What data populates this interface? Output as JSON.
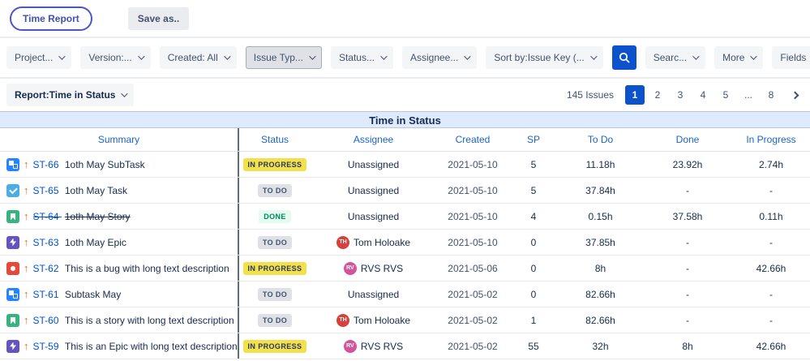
{
  "header": {
    "time_report_label": "Time Report",
    "save_as_label": "Save as.."
  },
  "filters": {
    "project": "Project...",
    "version": "Version:...",
    "created": "Created: All",
    "issue_type": "Issue Typ...",
    "status": "Status...",
    "assignee": "Assignee...",
    "sort_by": "Sort by:Issue Key (...",
    "search": "Searc...",
    "more": "More",
    "fields": "Fields"
  },
  "report_bar": {
    "report_selector_label": "Report:Time in Status",
    "issues_count": "145 Issues",
    "pages": [
      "1",
      "2",
      "3",
      "4",
      "5",
      "...",
      "8"
    ],
    "active_page": "1"
  },
  "table": {
    "title": "Time in Status",
    "columns": [
      "Summary",
      "Status",
      "Assignee",
      "Created",
      "SP",
      "To Do",
      "Done",
      "In Progress"
    ],
    "rows": [
      {
        "issue_type": "subtask",
        "priority": "high",
        "key": "ST-66",
        "summary": "1oth May SubTask",
        "resolved": false,
        "status": "IN PROGRESS",
        "assignee": "Unassigned",
        "avatar": null,
        "created": "2021-05-10",
        "sp": "5",
        "to_do": "11.18h",
        "done": "23.92h",
        "in_progress": "2.74h"
      },
      {
        "issue_type": "task",
        "priority": "high",
        "key": "ST-65",
        "summary": "1oth May Task",
        "resolved": false,
        "status": "TO DO",
        "assignee": "Unassigned",
        "avatar": null,
        "created": "2021-05-10",
        "sp": "5",
        "to_do": "37.84h",
        "done": "-",
        "in_progress": "-"
      },
      {
        "issue_type": "story",
        "priority": "high",
        "key": "ST-64",
        "summary": "1oth May Story",
        "resolved": true,
        "status": "DONE",
        "assignee": "Unassigned",
        "avatar": null,
        "created": "2021-05-10",
        "sp": "4",
        "to_do": "0.15h",
        "done": "37.58h",
        "in_progress": "0.11h"
      },
      {
        "issue_type": "epic",
        "priority": "high",
        "key": "ST-63",
        "summary": "1oth May Epic",
        "resolved": false,
        "status": "TO DO",
        "assignee": "Tom Holoake",
        "avatar": {
          "color": "#D5423B",
          "initials": "TH"
        },
        "created": "2021-05-10",
        "sp": "0",
        "to_do": "37.85h",
        "done": "-",
        "in_progress": "-"
      },
      {
        "issue_type": "bug",
        "priority": "high",
        "key": "ST-62",
        "summary": "This is a bug with long text description",
        "resolved": false,
        "status": "IN PROGRESS",
        "assignee": "RVS RVS",
        "avatar": {
          "color": "#D4549C",
          "initials": "RV"
        },
        "created": "2021-05-06",
        "sp": "0",
        "to_do": "8h",
        "done": "-",
        "in_progress": "42.66h"
      },
      {
        "issue_type": "subtask",
        "priority": "high",
        "key": "ST-61",
        "summary": "Subtask May",
        "resolved": false,
        "status": "TO DO",
        "assignee": "Unassigned",
        "avatar": null,
        "created": "2021-05-02",
        "sp": "0",
        "to_do": "82.66h",
        "done": "-",
        "in_progress": "-"
      },
      {
        "issue_type": "story",
        "priority": "high",
        "key": "ST-60",
        "summary": "This is a story with long text description",
        "resolved": false,
        "status": "TO DO",
        "assignee": "Tom Holoake",
        "avatar": {
          "color": "#D5423B",
          "initials": "TH"
        },
        "created": "2021-05-02",
        "sp": "1",
        "to_do": "82.66h",
        "done": "-",
        "in_progress": "-"
      },
      {
        "issue_type": "epic",
        "priority": "high",
        "key": "ST-59",
        "summary": "This is an Epic with long text description",
        "resolved": false,
        "status": "IN PROGRESS",
        "assignee": "RVS RVS",
        "avatar": {
          "color": "#D4549C",
          "initials": "RV"
        },
        "created": "2021-05-02",
        "sp": "55",
        "to_do": "32h",
        "done": "8h",
        "in_progress": "42.66h"
      }
    ]
  },
  "colors": {
    "accent_blue": "#0C52CC",
    "link_blue": "#0052CC",
    "band_blue": "#DEEBFF",
    "badge_in_progress": "#F4E04D",
    "badge_to_do": "#DFE1E6",
    "badge_done_bg": "#E3FCEF",
    "badge_done_text": "#00875A",
    "priority_arrow": "#E9662B"
  }
}
